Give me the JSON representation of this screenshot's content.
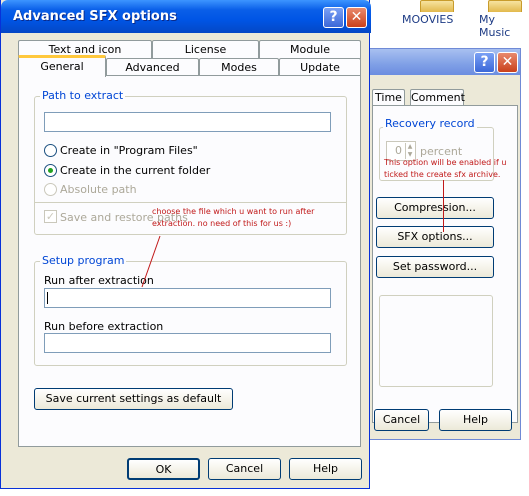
{
  "desktop": {
    "icon1_label": "MOOVIES",
    "icon2_label": "My Music"
  },
  "background_window": {
    "tabs": [
      "Time",
      "Comment"
    ],
    "recovery_group_label": "Recovery record",
    "recovery_value": "0",
    "recovery_unit": "percent",
    "buttons": {
      "compression": "Compression...",
      "sfx_options": "SFX options...",
      "set_password": "Set password...",
      "cancel": "Cancel",
      "help": "Help"
    },
    "annotation": [
      "This option will be enabled if u",
      "ticked the create sfx archive."
    ]
  },
  "dialog": {
    "title": "Advanced SFX options",
    "tabs_row1": [
      "Text and icon",
      "License",
      "Module"
    ],
    "tabs_row2": [
      "General",
      "Advanced",
      "Modes",
      "Update"
    ],
    "active_tab": "General",
    "path_group_label": "Path to extract",
    "path_value": "",
    "radio_program_files": "Create in \"Program Files\"",
    "radio_current_folder": "Create in the current folder",
    "radio_absolute_path": "Absolute path",
    "checkbox_save_restore": "Save and restore paths",
    "setup_group_label": "Setup program",
    "run_after_label": "Run after extraction",
    "run_after_value": "",
    "run_before_label": "Run before extraction",
    "run_before_value": "",
    "save_default_button": "Save current settings as default",
    "ok_button": "OK",
    "cancel_button": "Cancel",
    "help_button": "Help",
    "annotation": [
      "choose the file which u want to run after",
      "extraction. no need of this for us :)"
    ]
  },
  "colors": {
    "title_blue": "#0055e5",
    "annotation_red": "#c11a1a",
    "tab_highlight": "#ffc83c"
  }
}
